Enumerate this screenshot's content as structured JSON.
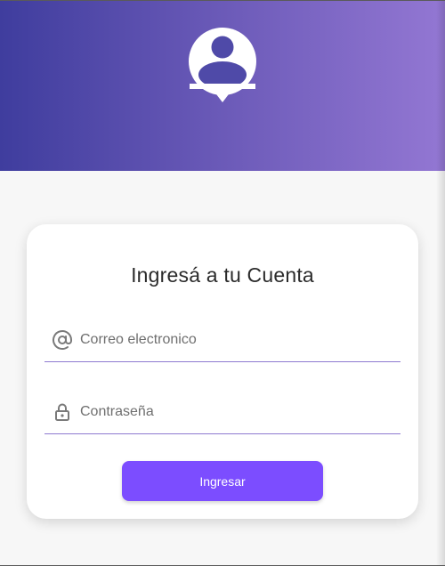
{
  "colors": {
    "header_gradient_start": "#3f3d9e",
    "header_gradient_end": "#9377d3",
    "accent": "#7c4dff",
    "field_underline": "#8e7ad0",
    "background": "#f7f7f7",
    "card": "#ffffff"
  },
  "header": {
    "icon": "user-location-icon"
  },
  "login_card": {
    "title": "Ingresá a tu Cuenta",
    "email": {
      "icon": "at-sign-icon",
      "placeholder": "Correo electronico",
      "value": ""
    },
    "password": {
      "icon": "lock-icon",
      "placeholder": "Contraseña",
      "value": ""
    },
    "submit_label": "Ingresar"
  }
}
